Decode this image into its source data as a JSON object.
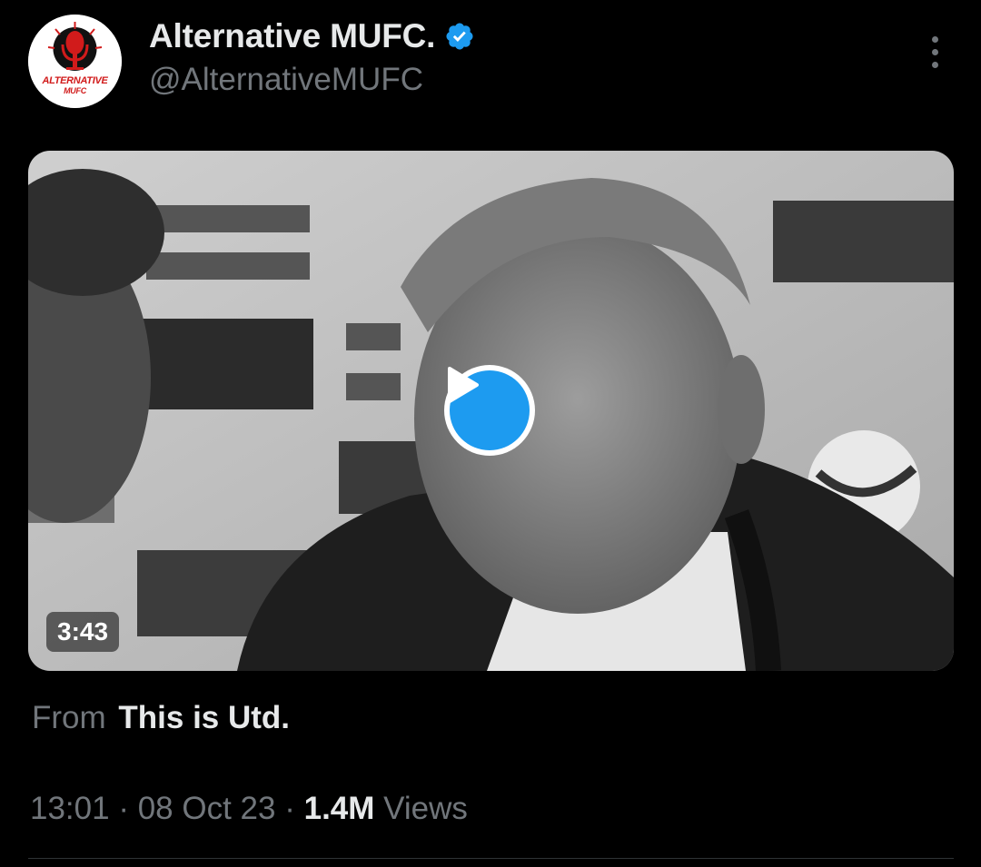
{
  "tweet": {
    "author": {
      "display_name": "Alternative MUFC.",
      "handle": "@AlternativeMUFC",
      "verified": true,
      "avatar_text_top": "ALTERNATIVE",
      "avatar_text_bottom": "MUFC"
    },
    "media": {
      "type": "video",
      "duration": "3:43",
      "play_icon": "play-icon"
    },
    "source": {
      "prefix": "From",
      "name": "This is Utd."
    },
    "meta": {
      "time": "13:01",
      "separator": "·",
      "date": "08 Oct 23",
      "views_count": "1.4M",
      "views_label": "Views"
    }
  },
  "colors": {
    "background": "#000000",
    "primary_text": "#e7e9ea",
    "secondary_text": "#71767b",
    "accent_blue": "#1d9bf0",
    "divider": "#2f3336",
    "avatar_red": "#d11b1b"
  }
}
